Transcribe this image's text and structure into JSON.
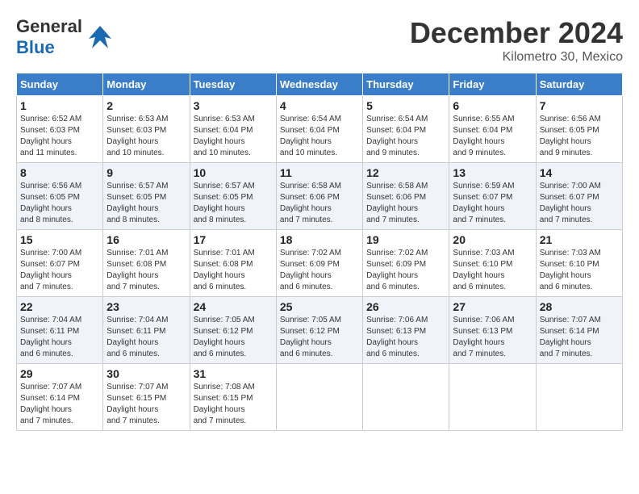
{
  "header": {
    "logo_general": "General",
    "logo_blue": "Blue",
    "month_title": "December 2024",
    "location": "Kilometro 30, Mexico"
  },
  "days_of_week": [
    "Sunday",
    "Monday",
    "Tuesday",
    "Wednesday",
    "Thursday",
    "Friday",
    "Saturday"
  ],
  "weeks": [
    [
      {
        "day": "1",
        "sunrise": "6:52 AM",
        "sunset": "6:03 PM",
        "daylight": "11 hours and 11 minutes."
      },
      {
        "day": "2",
        "sunrise": "6:53 AM",
        "sunset": "6:03 PM",
        "daylight": "11 hours and 10 minutes."
      },
      {
        "day": "3",
        "sunrise": "6:53 AM",
        "sunset": "6:04 PM",
        "daylight": "11 hours and 10 minutes."
      },
      {
        "day": "4",
        "sunrise": "6:54 AM",
        "sunset": "6:04 PM",
        "daylight": "11 hours and 10 minutes."
      },
      {
        "day": "5",
        "sunrise": "6:54 AM",
        "sunset": "6:04 PM",
        "daylight": "11 hours and 9 minutes."
      },
      {
        "day": "6",
        "sunrise": "6:55 AM",
        "sunset": "6:04 PM",
        "daylight": "11 hours and 9 minutes."
      },
      {
        "day": "7",
        "sunrise": "6:56 AM",
        "sunset": "6:05 PM",
        "daylight": "11 hours and 9 minutes."
      }
    ],
    [
      {
        "day": "8",
        "sunrise": "6:56 AM",
        "sunset": "6:05 PM",
        "daylight": "11 hours and 8 minutes."
      },
      {
        "day": "9",
        "sunrise": "6:57 AM",
        "sunset": "6:05 PM",
        "daylight": "11 hours and 8 minutes."
      },
      {
        "day": "10",
        "sunrise": "6:57 AM",
        "sunset": "6:05 PM",
        "daylight": "11 hours and 8 minutes."
      },
      {
        "day": "11",
        "sunrise": "6:58 AM",
        "sunset": "6:06 PM",
        "daylight": "11 hours and 7 minutes."
      },
      {
        "day": "12",
        "sunrise": "6:58 AM",
        "sunset": "6:06 PM",
        "daylight": "11 hours and 7 minutes."
      },
      {
        "day": "13",
        "sunrise": "6:59 AM",
        "sunset": "6:07 PM",
        "daylight": "11 hours and 7 minutes."
      },
      {
        "day": "14",
        "sunrise": "7:00 AM",
        "sunset": "6:07 PM",
        "daylight": "11 hours and 7 minutes."
      }
    ],
    [
      {
        "day": "15",
        "sunrise": "7:00 AM",
        "sunset": "6:07 PM",
        "daylight": "11 hours and 7 minutes."
      },
      {
        "day": "16",
        "sunrise": "7:01 AM",
        "sunset": "6:08 PM",
        "daylight": "11 hours and 7 minutes."
      },
      {
        "day": "17",
        "sunrise": "7:01 AM",
        "sunset": "6:08 PM",
        "daylight": "11 hours and 6 minutes."
      },
      {
        "day": "18",
        "sunrise": "7:02 AM",
        "sunset": "6:09 PM",
        "daylight": "11 hours and 6 minutes."
      },
      {
        "day": "19",
        "sunrise": "7:02 AM",
        "sunset": "6:09 PM",
        "daylight": "11 hours and 6 minutes."
      },
      {
        "day": "20",
        "sunrise": "7:03 AM",
        "sunset": "6:10 PM",
        "daylight": "11 hours and 6 minutes."
      },
      {
        "day": "21",
        "sunrise": "7:03 AM",
        "sunset": "6:10 PM",
        "daylight": "11 hours and 6 minutes."
      }
    ],
    [
      {
        "day": "22",
        "sunrise": "7:04 AM",
        "sunset": "6:11 PM",
        "daylight": "11 hours and 6 minutes."
      },
      {
        "day": "23",
        "sunrise": "7:04 AM",
        "sunset": "6:11 PM",
        "daylight": "11 hours and 6 minutes."
      },
      {
        "day": "24",
        "sunrise": "7:05 AM",
        "sunset": "6:12 PM",
        "daylight": "11 hours and 6 minutes."
      },
      {
        "day": "25",
        "sunrise": "7:05 AM",
        "sunset": "6:12 PM",
        "daylight": "11 hours and 6 minutes."
      },
      {
        "day": "26",
        "sunrise": "7:06 AM",
        "sunset": "6:13 PM",
        "daylight": "11 hours and 6 minutes."
      },
      {
        "day": "27",
        "sunrise": "7:06 AM",
        "sunset": "6:13 PM",
        "daylight": "11 hours and 7 minutes."
      },
      {
        "day": "28",
        "sunrise": "7:07 AM",
        "sunset": "6:14 PM",
        "daylight": "11 hours and 7 minutes."
      }
    ],
    [
      {
        "day": "29",
        "sunrise": "7:07 AM",
        "sunset": "6:14 PM",
        "daylight": "11 hours and 7 minutes."
      },
      {
        "day": "30",
        "sunrise": "7:07 AM",
        "sunset": "6:15 PM",
        "daylight": "11 hours and 7 minutes."
      },
      {
        "day": "31",
        "sunrise": "7:08 AM",
        "sunset": "6:15 PM",
        "daylight": "11 hours and 7 minutes."
      },
      null,
      null,
      null,
      null
    ]
  ]
}
